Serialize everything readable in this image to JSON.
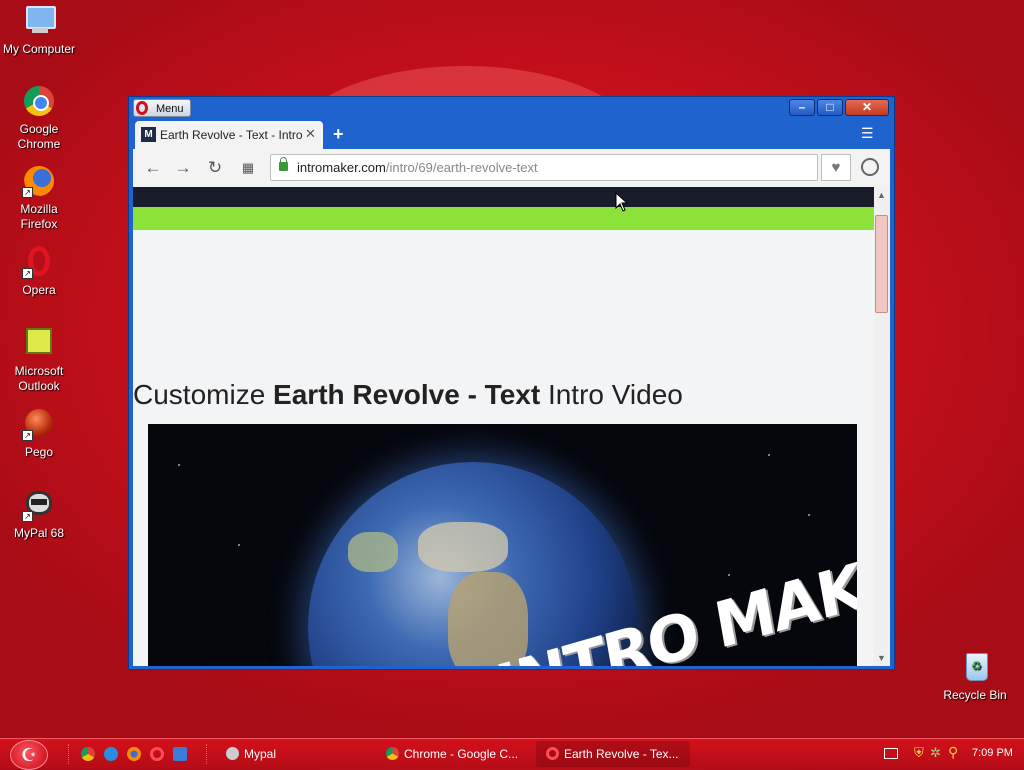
{
  "desktop": {
    "icons": [
      {
        "label": "My Computer",
        "icon": "computer-icon"
      },
      {
        "label": "Google\nChrome",
        "icon": "chrome-icon"
      },
      {
        "label": "Mozilla\nFirefox",
        "icon": "firefox-icon"
      },
      {
        "label": "Opera",
        "icon": "opera-icon"
      },
      {
        "label": "Microsoft\nOutlook",
        "icon": "outlook-icon"
      },
      {
        "label": "Pego",
        "icon": "pego-icon"
      },
      {
        "label": "MyPal 68",
        "icon": "mypal-icon"
      },
      {
        "label": "Recycle Bin",
        "icon": "recycle-bin-icon"
      }
    ]
  },
  "browser": {
    "menu_label": "Menu",
    "tab_title": "Earth Revolve - Text - Intro M",
    "tab_favicon": "M",
    "url_domain": "intromaker.com",
    "url_path": "/intro/69/earth-revolve-text"
  },
  "page": {
    "heading_pre": "Customize ",
    "heading_bold": "Earth Revolve - Text",
    "heading_post": " Intro Video",
    "video_text": "INTRO MAKER",
    "accent_green": "#8de23a"
  },
  "taskbar": {
    "buttons": [
      {
        "label": "Mypal"
      },
      {
        "label": "Chrome - Google C..."
      },
      {
        "label": "Earth Revolve - Tex..."
      }
    ],
    "clock": "7:09 PM"
  }
}
